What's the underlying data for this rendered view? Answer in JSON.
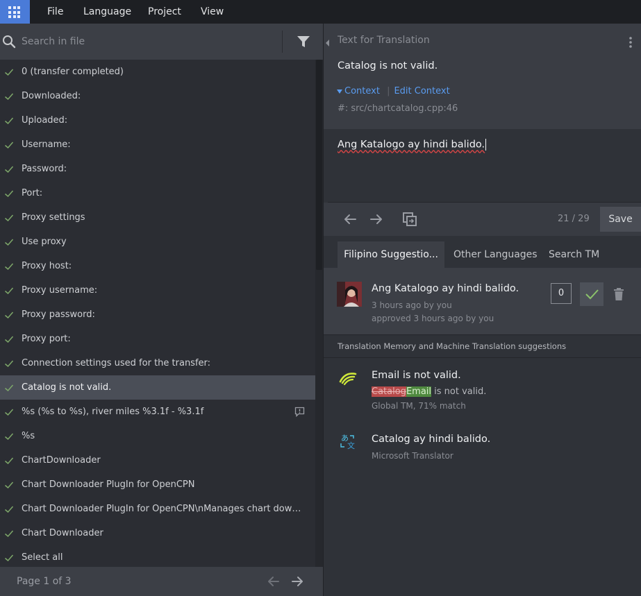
{
  "menu": {
    "items": [
      "File",
      "Language",
      "Project",
      "View"
    ]
  },
  "search": {
    "placeholder": "Search in file",
    "value": ""
  },
  "strings": {
    "selected_index": 13,
    "items": [
      {
        "label": "0 (transfer completed)",
        "has_comment": false
      },
      {
        "label": "Downloaded:",
        "has_comment": false
      },
      {
        "label": "Uploaded:",
        "has_comment": false
      },
      {
        "label": "Username:",
        "has_comment": false
      },
      {
        "label": "Password:",
        "has_comment": false
      },
      {
        "label": "Port:",
        "has_comment": false
      },
      {
        "label": "Proxy settings",
        "has_comment": false
      },
      {
        "label": "Use proxy",
        "has_comment": false
      },
      {
        "label": "Proxy host:",
        "has_comment": false
      },
      {
        "label": "Proxy username:",
        "has_comment": false
      },
      {
        "label": "Proxy password:",
        "has_comment": false
      },
      {
        "label": "Proxy port:",
        "has_comment": false
      },
      {
        "label": "Connection settings used for the transfer:",
        "has_comment": false
      },
      {
        "label": "Catalog is not valid.",
        "has_comment": false
      },
      {
        "label": "%s (%s to %s), river miles %3.1f - %3.1f",
        "has_comment": true
      },
      {
        "label": "%s",
        "has_comment": false
      },
      {
        "label": "ChartDownloader",
        "has_comment": false
      },
      {
        "label": "Chart Downloader PlugIn for OpenCPN",
        "has_comment": false
      },
      {
        "label": "Chart Downloader PlugIn for OpenCPN\\nManages chart downloa...",
        "has_comment": false
      },
      {
        "label": "Chart Downloader",
        "has_comment": false
      },
      {
        "label": "Select all",
        "has_comment": false
      }
    ]
  },
  "pager": {
    "label": "Page 1 of 3"
  },
  "source": {
    "title": "Text for Translation",
    "text": "Catalog is not valid.",
    "context_toggle": "Context",
    "edit_context": "Edit Context",
    "reference": "#: src/chartcatalog.cpp:46"
  },
  "translation": {
    "text": "Ang Katalogo ay hindi balido."
  },
  "toolbar": {
    "counter": "21 / 29",
    "save_label": "Save"
  },
  "tabs": [
    "Filipino Suggestio...",
    "Other Languages",
    "Search TM"
  ],
  "suggestion": {
    "text": "Ang Katalogo ay hindi balido.",
    "meta1": "3 hours ago by you",
    "meta2": "approved 3 hours ago by you",
    "votes": "0"
  },
  "tm": {
    "header": "Translation Memory and Machine Translation suggestions",
    "items": [
      {
        "text": "Email is not valid.",
        "diff_removed": "Catalog",
        "diff_added": "Email",
        "diff_rest": " is not valid.",
        "source": "Global TM, 71% match",
        "icon": "global-tm-icon"
      },
      {
        "text": "Catalog ay hindi balido.",
        "source": "Microsoft Translator",
        "icon": "microsoft-translator-icon"
      }
    ]
  },
  "colors": {
    "accent": "#4a7bd8",
    "link": "#5a9cf0",
    "check": "#7ea86a",
    "diff_removed": "#b84a4a",
    "diff_added": "#4f8a3f"
  }
}
